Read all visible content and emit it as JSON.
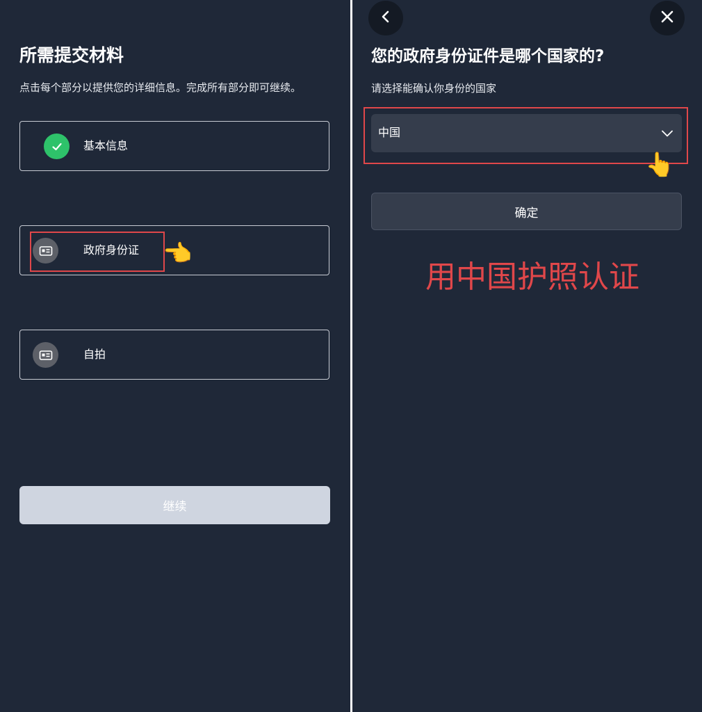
{
  "left": {
    "title": "所需提交材料",
    "subtitle": "点击每个部分以提供您的详细信息。完成所有部分即可继续。",
    "items": [
      {
        "label": "基本信息",
        "icon": "check-icon",
        "status": "completed"
      },
      {
        "label": "政府身份证",
        "icon": "id-card-icon",
        "status": "pending"
      },
      {
        "label": "自拍",
        "icon": "id-card-icon",
        "status": "pending"
      }
    ],
    "continue_label": "继续"
  },
  "right": {
    "back_icon": "chevron-left-icon",
    "close_icon": "close-icon",
    "title": "您的政府身份证件是哪个国家的?",
    "subtitle": "请选择能确认你身份的国家",
    "country_selected": "中国",
    "confirm_label": "确定",
    "annotation": "用中国护照认证"
  },
  "colors": {
    "background": "#1f2838",
    "highlight": "#e0474a",
    "success": "#2ec26a",
    "select_bg": "#353d4c",
    "disabled_button": "#cfd5e0"
  }
}
